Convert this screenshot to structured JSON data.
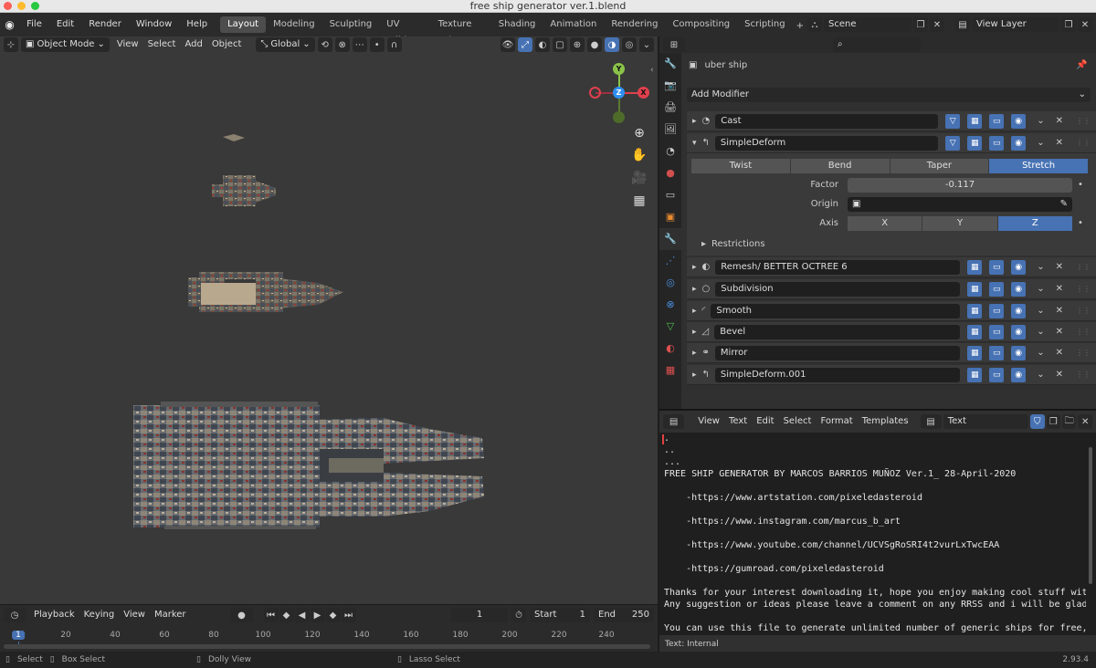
{
  "window": {
    "title": "free ship generator ver.1.blend"
  },
  "menu": [
    "File",
    "Edit",
    "Render",
    "Window",
    "Help"
  ],
  "workspaces": [
    "Layout",
    "Modeling",
    "Sculpting",
    "UV Editing",
    "Texture Paint",
    "Shading",
    "Animation",
    "Rendering",
    "Compositing",
    "Scripting"
  ],
  "workspace_add": "+",
  "scene": {
    "name": "Scene",
    "view_layer": "View Layer"
  },
  "viewport": {
    "mode": "Object Mode",
    "menus": [
      "View",
      "Select",
      "Add",
      "Object"
    ],
    "orientation": "Global",
    "gizmo_labels": {
      "y": "Y",
      "z": "Z",
      "x": "X"
    }
  },
  "timeline": {
    "menus": [
      "Playback",
      "Keying",
      "View",
      "Marker"
    ],
    "current_frame": "1",
    "start_label": "Start",
    "start": "1",
    "end_label": "End",
    "end": "250",
    "ruler": [
      "1",
      "20",
      "40",
      "60",
      "80",
      "100",
      "120",
      "140",
      "160",
      "180",
      "200",
      "220",
      "240"
    ]
  },
  "status": {
    "select": "Select",
    "box_select": "Box Select",
    "dolly": "Dolly View",
    "lasso": "Lasso Select",
    "version": "2.93.4"
  },
  "properties": {
    "object_name": "uber ship",
    "add_modifier": "Add Modifier",
    "modifiers": [
      {
        "name": "Cast",
        "expanded": false
      },
      {
        "name": "SimpleDeform",
        "expanded": true
      },
      {
        "name": "Remesh/ BETTER OCTREE 6",
        "expanded": false
      },
      {
        "name": "Subdivision",
        "expanded": false
      },
      {
        "name": "Smooth",
        "expanded": false
      },
      {
        "name": "Bevel",
        "expanded": false
      },
      {
        "name": "Mirror",
        "expanded": false
      },
      {
        "name": "SimpleDeform.001",
        "expanded": false
      }
    ],
    "deform": {
      "methods": [
        "Twist",
        "Bend",
        "Taper",
        "Stretch"
      ],
      "active_method": "Stretch",
      "factor_label": "Factor",
      "factor": "-0.117",
      "origin_label": "Origin",
      "axis_label": "Axis",
      "axes": [
        "X",
        "Y",
        "Z"
      ],
      "active_axis": "Z",
      "restrictions": "Restrictions"
    }
  },
  "text_editor": {
    "menus": [
      "View",
      "Text",
      "Edit",
      "Select",
      "Format",
      "Templates"
    ],
    "datablock": "Text",
    "lines": [
      ".",
      "..",
      "...",
      "FREE SHIP GENERATOR BY MARCOS BARRIOS MUÑOZ Ver.1_ 28-April-2020",
      "",
      "    -https://www.artstation.com/pixeledasteroid",
      "",
      "    -https://www.instagram.com/marcus_b_art",
      "",
      "    -https://www.youtube.com/channel/UCVSgRoSRI4t2vurLxTwcEAA",
      "",
      "    -https://gumroad.com/pixeledasteroid",
      "",
      "Thanks for your interest downloading it, hope you enjoy making cool stuff with",
      "Any suggestion or ideas please leave a comment on any RRSS and i will be glad t",
      "",
      "You can use this file to generate unlimited number of generic ships for free, y"
    ],
    "footer": "Text: Internal"
  },
  "colors": {
    "accent": "#4772b3",
    "viewport_bg": "#393939",
    "axis_x": "#e0404e",
    "axis_y": "#8bc34a",
    "axis_z": "#2f8ff0"
  }
}
